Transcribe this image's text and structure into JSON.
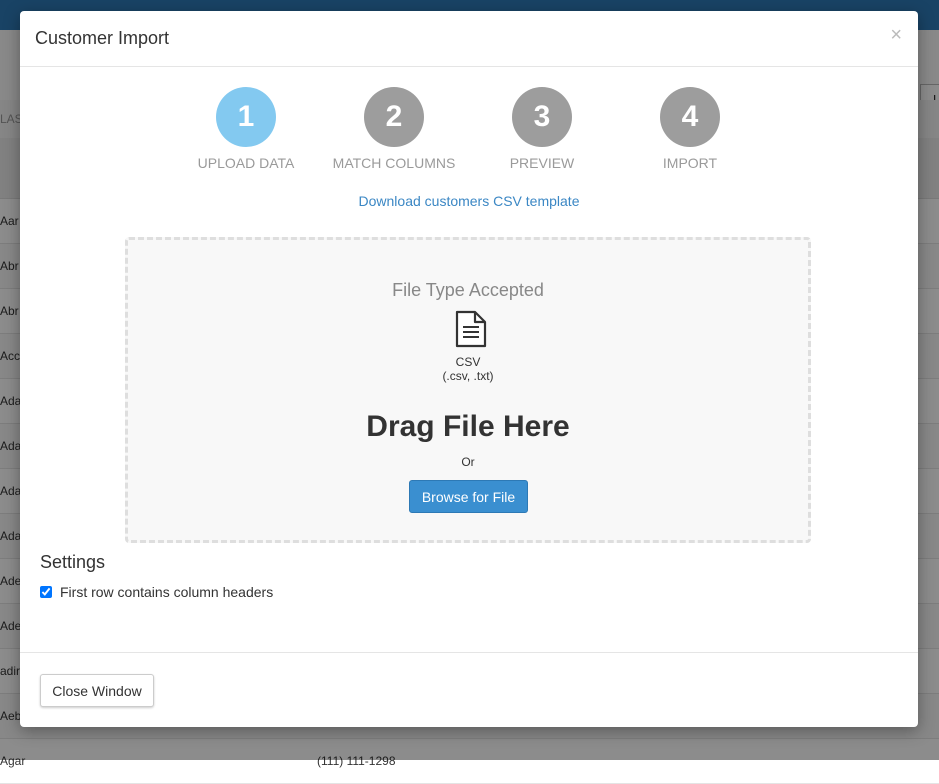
{
  "background": {
    "column_header": "LAS",
    "button_label": "U",
    "rows": [
      {
        "name": "Aar",
        "phone": ""
      },
      {
        "name": "Abr",
        "phone": ""
      },
      {
        "name": "Abr",
        "phone": ""
      },
      {
        "name": "Acc",
        "phone": ""
      },
      {
        "name": "Ada",
        "phone": ""
      },
      {
        "name": "Ada",
        "phone": ""
      },
      {
        "name": "Ada",
        "phone": ""
      },
      {
        "name": "Ada",
        "phone": ""
      },
      {
        "name": "Ade",
        "phone": ""
      },
      {
        "name": "Ade",
        "phone": ""
      },
      {
        "name": "adir",
        "phone": ""
      },
      {
        "name": "Aeb",
        "phone": ""
      },
      {
        "name": "Agar",
        "phone": "(111) 111-1298"
      }
    ]
  },
  "modal": {
    "title": "Customer Import",
    "close_glyph": "×",
    "steps": [
      {
        "number": "1",
        "label": "UPLOAD DATA",
        "active": true
      },
      {
        "number": "2",
        "label": "MATCH COLUMNS",
        "active": false
      },
      {
        "number": "3",
        "label": "PREVIEW",
        "active": false
      },
      {
        "number": "4",
        "label": "IMPORT",
        "active": false
      }
    ],
    "template_link": "Download customers CSV template",
    "dropzone": {
      "heading": "File Type Accepted",
      "file_icon": "document-icon",
      "file_type": "CSV",
      "extensions": "(.csv, .txt)",
      "drag_text": "Drag File Here",
      "or_text": "Or",
      "browse_label": "Browse for File"
    },
    "settings": {
      "title": "Settings",
      "first_row_headers_label": "First row contains column headers",
      "first_row_headers_checked": true
    },
    "footer": {
      "close_label": "Close Window"
    }
  },
  "colors": {
    "active_step": "#83c9f0",
    "inactive_step": "#9d9d9d",
    "link": "#3b87c4",
    "primary_button": "#3a8fd0",
    "topbar": "#2f7bb8"
  }
}
